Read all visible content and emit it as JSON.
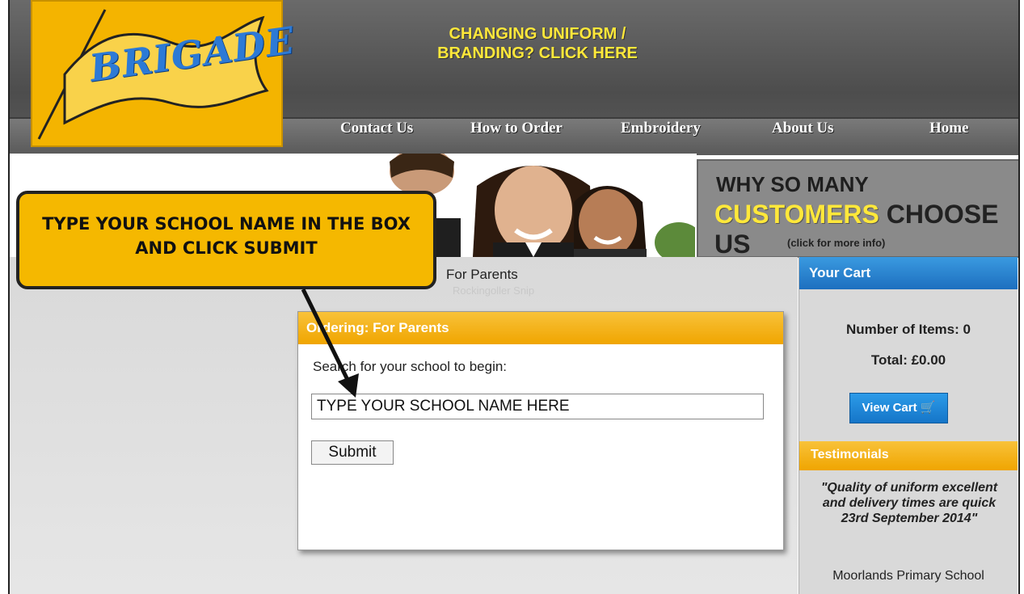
{
  "header": {
    "logo_text": "BRIGADE",
    "promo_line1": "CHANGING UNIFORM /",
    "promo_line2": "BRANDING? CLICK HERE"
  },
  "nav": {
    "items": [
      {
        "label": "Contact Us"
      },
      {
        "label": "How to Order"
      },
      {
        "label": "Embroidery"
      },
      {
        "label": "About Us"
      },
      {
        "label": "Home"
      }
    ]
  },
  "banner": {
    "why_line1": "WHY SO MANY",
    "why_customers": "CUSTOMERS",
    "why_choose": "CHOOSE US",
    "why_more": "(click for more info)"
  },
  "callout": {
    "line1": "TYPE YOUR SCHOOL NAME IN THE BOX",
    "line2": "AND CLICK SUBMIT"
  },
  "main": {
    "breadcrumb": "For Parents",
    "faded_text": "Rockingoller Snip"
  },
  "ordering": {
    "title": "Ordering: For Parents",
    "prompt": "Search for your school to begin:",
    "input_value": "TYPE YOUR SCHOOL NAME HERE",
    "submit_label": "Submit"
  },
  "cart": {
    "title": "Your Cart",
    "items_text": "Number of Items: 0",
    "total_text": "Total: £0.00",
    "view_label": "View Cart"
  },
  "testimonials": {
    "title": "Testimonials",
    "quote": "\"Quality of uniform excellent and delivery times are quick 23rd September 2014\"",
    "author": "Moorlands Primary School"
  },
  "colors": {
    "accent_yellow": "#f5b800",
    "header_gray": "#5a5a5a",
    "cart_blue": "#1d6fbf",
    "promo_yellow": "#ffe83a"
  }
}
